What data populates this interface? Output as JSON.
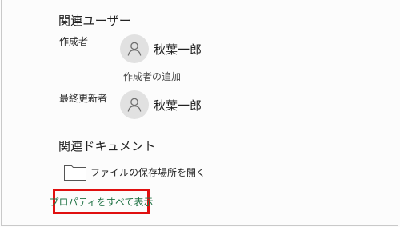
{
  "related_users": {
    "title": "関連ユーザー",
    "author": {
      "label": "作成者",
      "name": "秋葉一郎",
      "add_author": "作成者の追加"
    },
    "last_modified_by": {
      "label": "最終更新者",
      "name": "秋葉一郎"
    }
  },
  "related_documents": {
    "title": "関連ドキュメント",
    "open_file_location": "ファイルの保存場所を開く"
  },
  "show_all_properties": "プロパティをすべて表示",
  "colors": {
    "link_green": "#217346",
    "highlight_red": "#e01010",
    "avatar_gray": "#e1e1e1"
  },
  "icons": {
    "avatar": "person-icon",
    "folder": "folder-icon"
  }
}
